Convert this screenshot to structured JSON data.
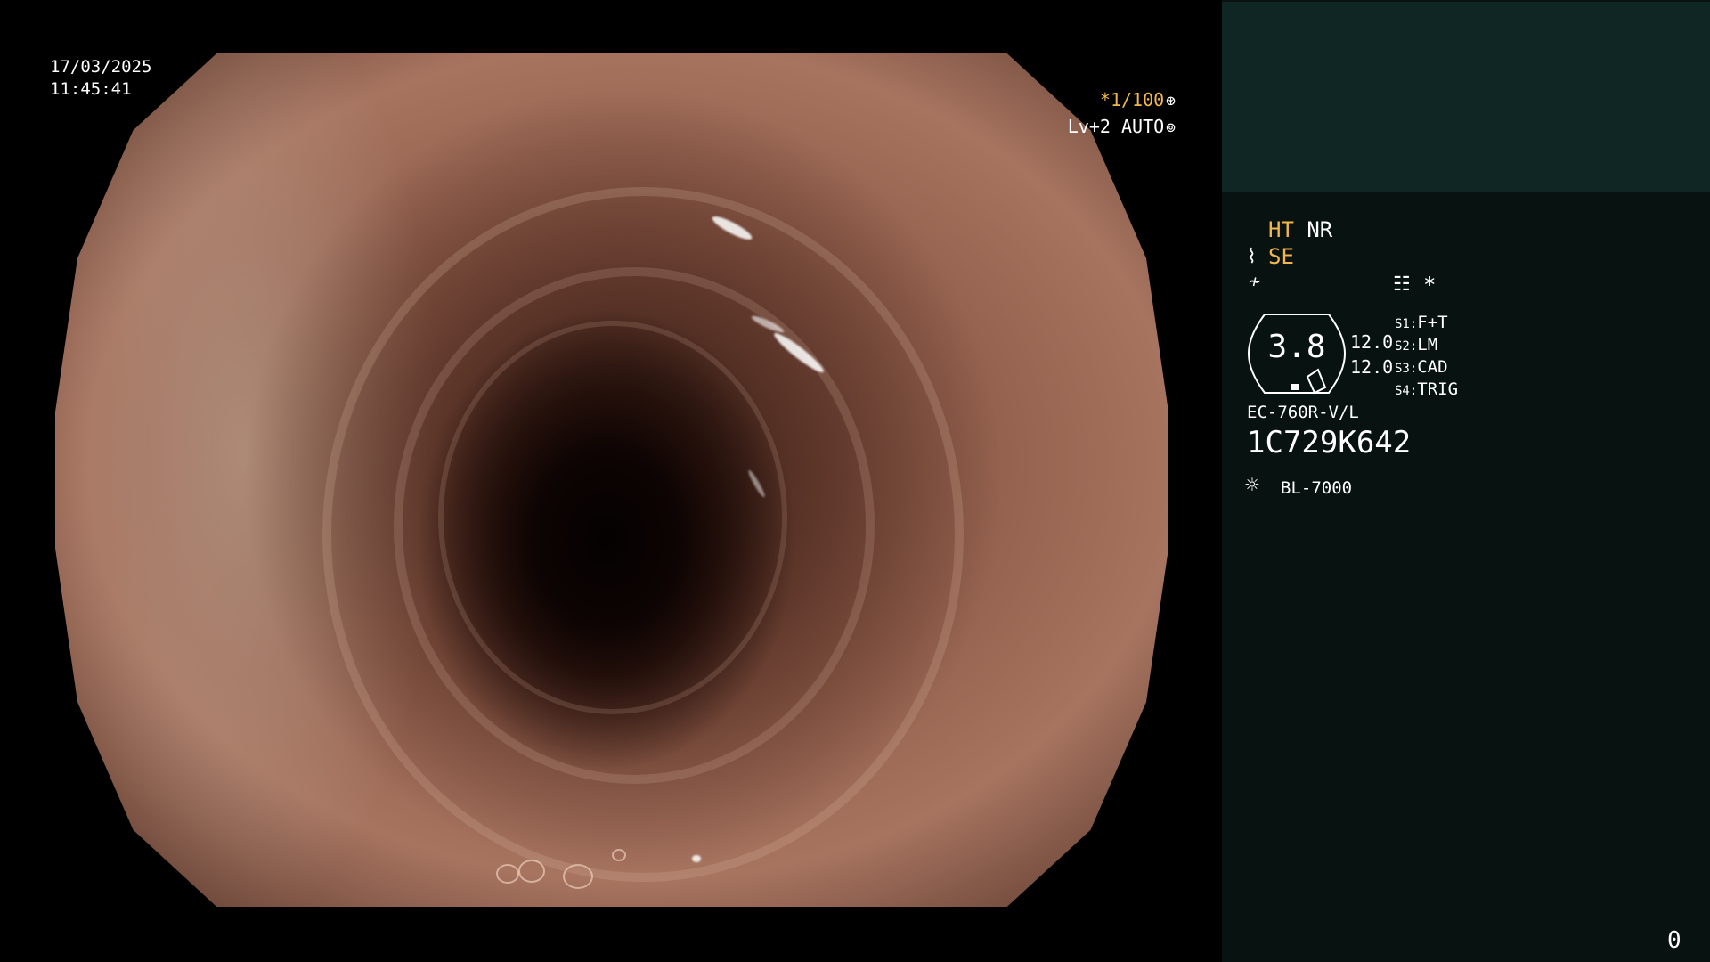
{
  "overlay": {
    "date": "17/03/2025",
    "time": "11:45:41",
    "shutter": "*1/100",
    "shutter_icon": "aperture-icon",
    "light_level": "Lv+2 AUTO",
    "light_icon": "iris-icon"
  },
  "panel": {
    "modes": {
      "ht": "HT",
      "nr": "NR",
      "se": "SE"
    },
    "icons": {
      "se": "SE-mode-icon",
      "filter": "filter-icon",
      "report": "report-icon",
      "lamp": "sun-icon"
    },
    "star": "*",
    "gauge_value": "3.8",
    "numbers": [
      "12.0",
      "12.0"
    ],
    "switches": [
      {
        "key": "S1",
        "value": "F+T"
      },
      {
        "key": "S2",
        "value": "LM"
      },
      {
        "key": "S3",
        "value": "CAD"
      },
      {
        "key": "S4",
        "value": "TRIG"
      }
    ],
    "scope_model": "EC-760R-V/L",
    "serial": "1C729K642",
    "light_source": "BL-7000",
    "counter": "0"
  },
  "colors": {
    "panel_bg": "#081210",
    "thumb_bg": "#102624",
    "accent_orange": "#f2b64a"
  }
}
